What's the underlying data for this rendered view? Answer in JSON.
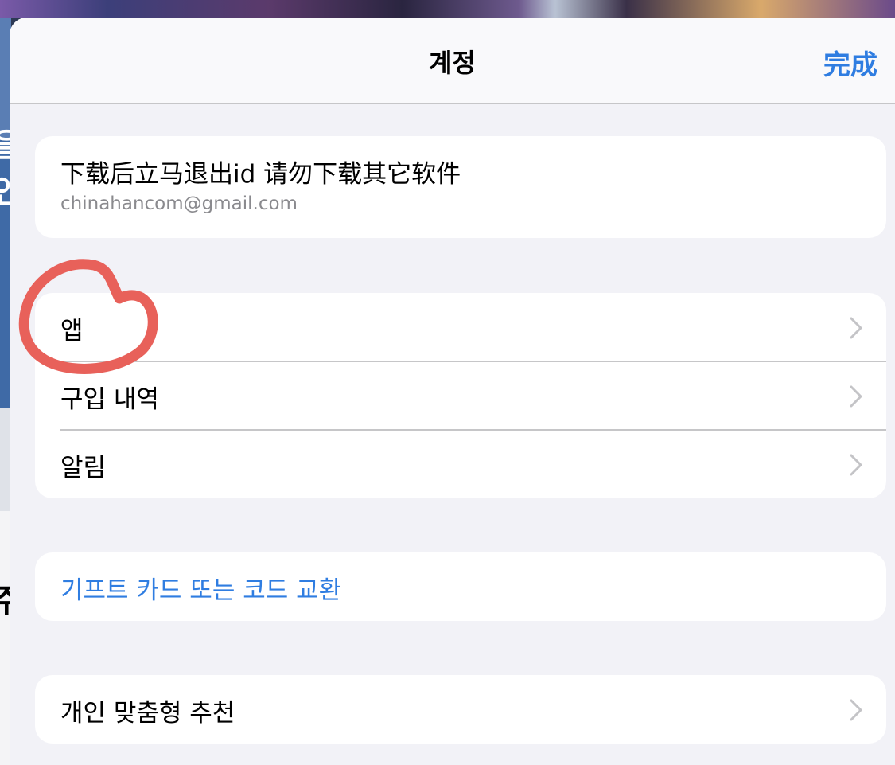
{
  "background": {
    "glyphs": [
      "을",
      "인",
      "주"
    ]
  },
  "sheet": {
    "title": "계정",
    "done_label": "完成"
  },
  "account": {
    "name": "下载后立马退出id 请勿下载其它软件",
    "email": "chinahancom@gmail.com"
  },
  "menu": {
    "items": [
      {
        "label": "앱"
      },
      {
        "label": "구입 내역"
      },
      {
        "label": "알림"
      }
    ]
  },
  "gift": {
    "label": "기프트 카드 또는 코드 교환"
  },
  "personalization": {
    "label": "개인 맞춤형 추천"
  },
  "colors": {
    "accent": "#2f7de1",
    "annotation": "#e8615a"
  }
}
